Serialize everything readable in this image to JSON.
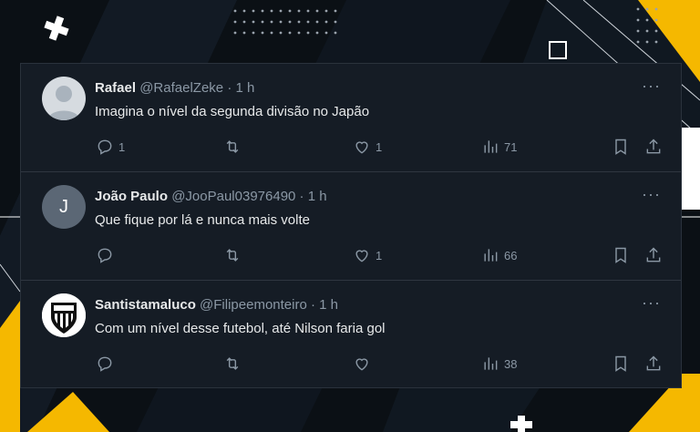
{
  "tweets": [
    {
      "name": "Rafael",
      "handle": "@RafaelZeke",
      "time": "· 1 h",
      "text": "Imagina o nível da segunda divisão no Japão",
      "avatar_letter": "",
      "replies": "1",
      "likes": "1",
      "views": "71"
    },
    {
      "name": "João Paulo",
      "handle": "@JooPaul03976490",
      "time": "· 1 h",
      "text": "Que fique por lá e nunca mais volte",
      "avatar_letter": "J",
      "replies": "",
      "likes": "1",
      "views": "66"
    },
    {
      "name": "Santistamaluco",
      "handle": "@Filipeemonteiro",
      "time": "· 1 h",
      "text": "Com um nível desse futebol, até Nilson faria gol",
      "avatar_letter": "",
      "replies": "",
      "likes": "",
      "views": "38"
    }
  ],
  "more_label": "···",
  "icons": [
    "reply-icon",
    "retweet-icon",
    "like-icon",
    "views-icon",
    "bookmark-icon",
    "share-icon"
  ],
  "colors": {
    "card_bg": "#151c25",
    "accent": "#f5b800",
    "text": "#e7e9ea",
    "muted": "#8b98a5"
  }
}
